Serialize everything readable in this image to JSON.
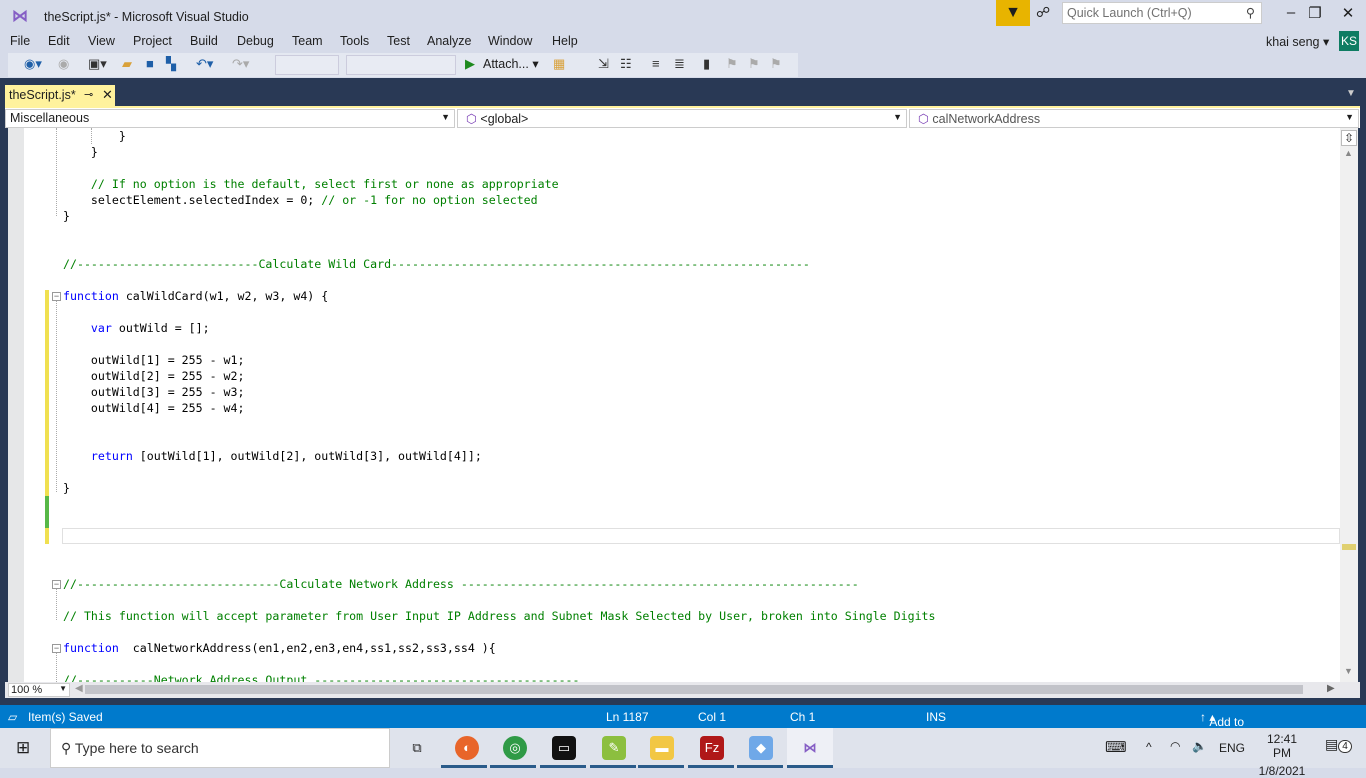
{
  "window": {
    "title": "theScript.js* - Microsoft Visual Studio",
    "quick_launch_placeholder": "Quick Launch (Ctrl+Q)",
    "user": "khai seng",
    "avatar_initials": "KS"
  },
  "menu": [
    "File",
    "Edit",
    "View",
    "Project",
    "Build",
    "Debug",
    "Team",
    "Tools",
    "Test",
    "Analyze",
    "Window",
    "Help"
  ],
  "toolbar": {
    "attach_label": "Attach..."
  },
  "tab": {
    "label": "theScript.js*"
  },
  "navbar": {
    "project": "Miscellaneous",
    "scope": "<global>",
    "member": "calNetworkAddress"
  },
  "editor": {
    "zoom": "100 %",
    "lines": [
      [
        [
          "p",
          "        }"
        ]
      ],
      [
        [
          "p",
          "    }"
        ]
      ],
      [],
      [
        [
          "c",
          "    // If no option is the default, select first or none as appropriate"
        ]
      ],
      [
        [
          "p",
          "    selectElement.selectedIndex = 0; "
        ],
        [
          "c",
          "// or -1 for no option selected"
        ]
      ],
      [
        [
          "p",
          "}"
        ]
      ],
      [],
      [],
      [
        [
          "c",
          "//--------------------------Calculate Wild Card------------------------------------------------------------"
        ]
      ],
      [],
      [
        [
          "k",
          "function"
        ],
        [
          "p",
          " calWildCard(w1, w2, w3, w4) {"
        ]
      ],
      [],
      [
        [
          "p",
          "    "
        ],
        [
          "k",
          "var"
        ],
        [
          "p",
          " outWild = [];"
        ]
      ],
      [],
      [
        [
          "p",
          "    outWild[1] = 255 - w1;"
        ]
      ],
      [
        [
          "p",
          "    outWild[2] = 255 - w2;"
        ]
      ],
      [
        [
          "p",
          "    outWild[3] = 255 - w3;"
        ]
      ],
      [
        [
          "p",
          "    outWild[4] = 255 - w4;"
        ]
      ],
      [],
      [],
      [
        [
          "p",
          "    "
        ],
        [
          "k",
          "return"
        ],
        [
          "p",
          " [outWild[1], outWild[2], outWild[3], outWild[4]];"
        ]
      ],
      [],
      [
        [
          "p",
          "}"
        ]
      ],
      [],
      [],
      [],
      [],
      [],
      [
        [
          "c",
          "//-----------------------------Calculate Network Address ---------------------------------------------------------"
        ]
      ],
      [],
      [
        [
          "c",
          "// This function will accept parameter from User Input IP Address and Subnet Mask Selected by User, broken into Single Digits"
        ]
      ],
      [],
      [
        [
          "k",
          "function"
        ],
        [
          "p",
          "  calNetworkAddress(en1,en2,en3,en4,ss1,ss2,ss3,ss4 ){"
        ]
      ],
      [],
      [
        [
          "c",
          "//-----------Network Address Output --------------------------------------"
        ]
      ]
    ]
  },
  "status": {
    "message": "Item(s) Saved",
    "line": "Ln 1187",
    "col": "Col 1",
    "ch": "Ch 1",
    "mode": "INS",
    "source_control": "Add to Source Control"
  },
  "taskbar": {
    "search_placeholder": "Type here to search",
    "language": "ENG",
    "time": "12:41 PM",
    "date": "1/8/2021",
    "notifications": "4"
  },
  "colors": {
    "keyword": "#0000ff",
    "comment": "#008000",
    "status_bar": "#007acc",
    "tab_active": "#fff29d",
    "change_saved": "#57b847",
    "change_unsaved": "#f0e050"
  }
}
